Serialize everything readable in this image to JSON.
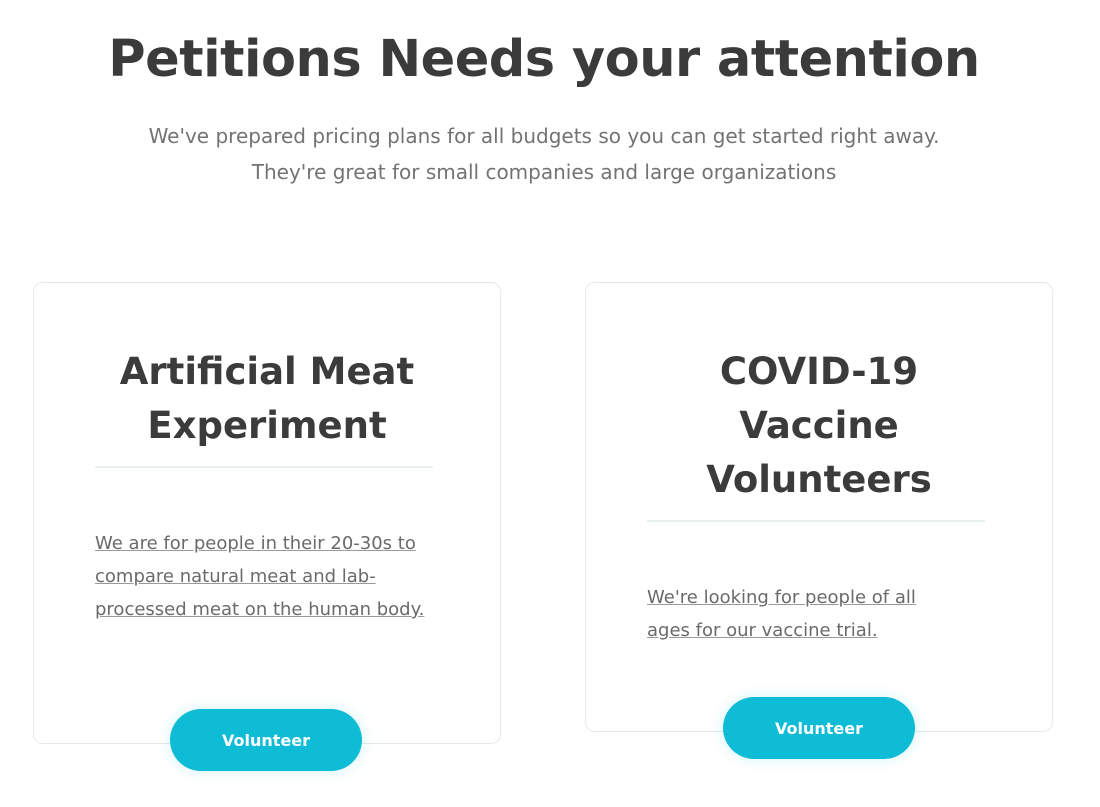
{
  "hero": {
    "title": "Petitions Needs your attention",
    "subtitle_line1": "We've prepared pricing plans for all budgets so you can get started right away.",
    "subtitle_line2": "They're great for small companies and large organizations"
  },
  "cards": [
    {
      "title_line1": "Artificial Meat",
      "title_line2": "Experiment",
      "description": "We are for people in their 20-30s to compare natural meat and lab-processed meat on the human body.",
      "button_label": "Volunteer"
    },
    {
      "title_line1": "COVID-19",
      "title_line2": "Vaccine",
      "title_line3": "Volunteers",
      "description": "We're looking for people of all ages for our vaccine trial.",
      "button_label": "Volunteer"
    }
  ],
  "colors": {
    "accent": "#0fbcd6",
    "heading": "#3b3b3b",
    "body_text": "#6a6a6a",
    "card_border": "#e4ebee"
  }
}
